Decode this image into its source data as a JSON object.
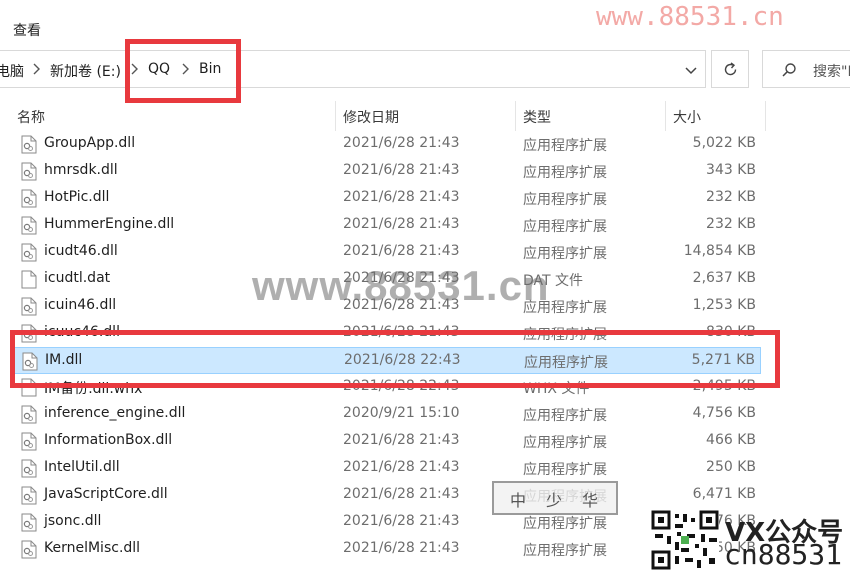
{
  "ribbon": {
    "view_tab": "查看"
  },
  "watermarks": {
    "top_url": "www.88531.cn",
    "center_url": "www.88531.cn",
    "seal_chars": [
      "中",
      "少",
      "华"
    ],
    "vx_label": "VX公众号",
    "code": "cn88531"
  },
  "address_bar": {
    "crumbs": [
      "电脑",
      "新加卷 (E:)",
      "QQ",
      "Bin"
    ]
  },
  "search": {
    "placeholder": "搜索\"Bin\""
  },
  "columns": {
    "name": "名称",
    "date": "修改日期",
    "type": "类型",
    "size": "大小"
  },
  "files": [
    {
      "name": "GroupApp.dll",
      "date": "2021/6/28 21:43",
      "type": "应用程序扩展",
      "size": "5,022 KB",
      "icon": "dll-file-icon"
    },
    {
      "name": "hmrsdk.dll",
      "date": "2021/6/28 21:43",
      "type": "应用程序扩展",
      "size": "343 KB",
      "icon": "dll-file-icon"
    },
    {
      "name": "HotPic.dll",
      "date": "2021/6/28 21:43",
      "type": "应用程序扩展",
      "size": "232 KB",
      "icon": "dll-file-icon"
    },
    {
      "name": "HummerEngine.dll",
      "date": "2021/6/28 21:43",
      "type": "应用程序扩展",
      "size": "232 KB",
      "icon": "dll-file-icon"
    },
    {
      "name": "icudt46.dll",
      "date": "2021/6/28 21:43",
      "type": "应用程序扩展",
      "size": "14,854 KB",
      "icon": "dll-file-icon"
    },
    {
      "name": "icudtl.dat",
      "date": "2021/6/28 21:43",
      "type": "DAT 文件",
      "size": "2,637 KB",
      "icon": "blank-file-icon"
    },
    {
      "name": "icuin46.dll",
      "date": "2021/6/28 21:43",
      "type": "应用程序扩展",
      "size": "1,253 KB",
      "icon": "dll-file-icon"
    },
    {
      "name": "icuuc46.dll",
      "date": "2021/6/28 21:43",
      "type": "应用程序扩展",
      "size": "830 KB",
      "icon": "dll-file-icon"
    },
    {
      "name": "IM.dll",
      "date": "2021/6/28 22:43",
      "type": "应用程序扩展",
      "size": "5,271 KB",
      "icon": "dll-file-icon",
      "selected": true
    },
    {
      "name": "IM备份.dll.whx",
      "date": "2021/6/28 22:43",
      "type": "WHX 文件",
      "size": "2,495 KB",
      "icon": "blank-file-icon"
    },
    {
      "name": "inference_engine.dll",
      "date": "2020/9/21 15:10",
      "type": "应用程序扩展",
      "size": "4,756 KB",
      "icon": "dll-file-icon"
    },
    {
      "name": "InformationBox.dll",
      "date": "2021/6/28 21:43",
      "type": "应用程序扩展",
      "size": "466 KB",
      "icon": "dll-file-icon"
    },
    {
      "name": "IntelUtil.dll",
      "date": "2021/6/28 21:43",
      "type": "应用程序扩展",
      "size": "250 KB",
      "icon": "dll-file-icon"
    },
    {
      "name": "JavaScriptCore.dll",
      "date": "2021/6/28 21:43",
      "type": "应用程序扩展",
      "size": "6,471 KB",
      "icon": "dll-file-icon"
    },
    {
      "name": "jsonc.dll",
      "date": "2021/6/28 21:43",
      "type": "应用程序扩展",
      "size": "76 KB",
      "icon": "dll-file-icon"
    },
    {
      "name": "KernelMisc.dll",
      "date": "2021/6/28 21:43",
      "type": "应用程序扩展",
      "size": "50 KB",
      "icon": "dll-file-icon"
    }
  ]
}
